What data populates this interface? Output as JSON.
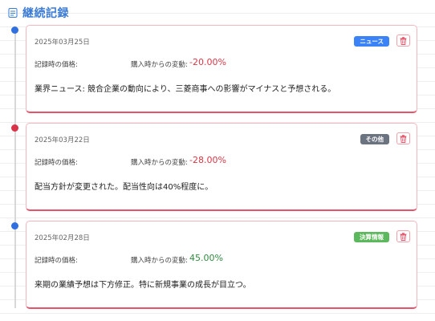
{
  "header": {
    "title": "継続記録"
  },
  "labels": {
    "price": "記録時の価格:",
    "change": "購入時からの変動:"
  },
  "records": [
    {
      "date": "2025年03月25日",
      "category": "ニュース",
      "category_color": "#3b82f6",
      "dot_color": "#2f6fe0",
      "change": "-20.00%",
      "change_color": "#dc3545",
      "note": "業界ニュース: 競合企業の動向により、三菱商事への影響がマイナスと予想される。"
    },
    {
      "date": "2025年03月22日",
      "category": "その他",
      "category_color": "#6b7280",
      "dot_color": "#d9334a",
      "change": "-28.00%",
      "change_color": "#dc3545",
      "note": "配当方針が変更された。配当性向は40%程度に。"
    },
    {
      "date": "2025年02月28日",
      "category": "決算情報",
      "category_color": "#5cb85c",
      "dot_color": "#2f6fe0",
      "change": "45.00%",
      "change_color": "#2e8b3e",
      "note": "来期の業績予想は下方修正。特に新規事業の成長が目立つ。"
    }
  ]
}
